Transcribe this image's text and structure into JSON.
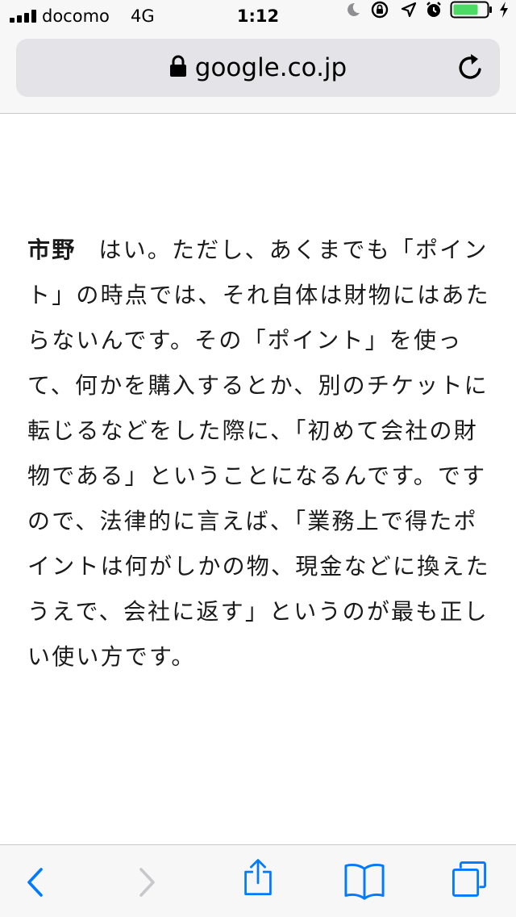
{
  "status_bar": {
    "carrier": "docomo",
    "network": "4G",
    "time": "1:12",
    "icons": [
      "signal-bars-icon",
      "moon-icon",
      "orientation-lock-icon",
      "location-arrow-icon",
      "alarm-icon",
      "battery-icon",
      "charging-bolt-icon"
    ],
    "battery_color": "#4cd964"
  },
  "url_bar": {
    "domain": "google.co.jp",
    "lock_icon": "lock-icon",
    "reload_icon": "reload-icon"
  },
  "article": {
    "speaker": "市野",
    "body": "はい。ただし、あくまでも「ポイント」の時点では、それ自体は財物にはあたらないんです。その「ポイント」を使って、何かを購入するとか、別のチケットに転じるなどをした際に、「初めて会社の財物である」ということになるんです。ですので、法律的に言えば、「業務上で得たポイントは何がしかの物、現金などに換えたうえで、会社に返す」というのが最も正しい使い方です。"
  },
  "toolbar": {
    "items": [
      "back-icon",
      "forward-icon",
      "share-icon",
      "bookmarks-icon",
      "tabs-icon"
    ],
    "accent_color": "#007aff",
    "disabled_color": "#c7c7cc"
  }
}
